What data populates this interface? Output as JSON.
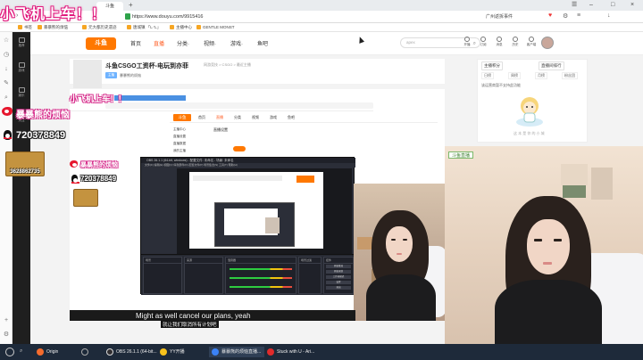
{
  "browser": {
    "tab_title": "斗鱼",
    "url": "https://www.douyu.com/9915416",
    "right_info": "广州返拆事件",
    "bookmarks": [
      "书签",
      "暴暴熊的烦恼",
      "元大都历史遗迹",
      "唐城镇 「L·'L」",
      "主播中心",
      "GENTLE MONST"
    ]
  },
  "overlay": {
    "title": "小飞机上车！！",
    "title_small": "小飞机上车！！",
    "name": "暴暴熊的烦恼",
    "qq": "720378849",
    "wechat": "3628862735",
    "name_small": "暴暴熊的烦恼",
    "qq_small": "720378849"
  },
  "dy_sidebar": [
    {
      "label": "推荐"
    },
    {
      "label": "游戏"
    },
    {
      "label": "娱乐"
    },
    {
      "label": "关注"
    }
  ],
  "header": {
    "logo": "斗鱼",
    "nav": [
      "首页",
      "直播",
      "分类·",
      "视频·",
      "游戏·",
      "鱼吧"
    ],
    "search_placeholder": "apex",
    "icons": [
      "开播",
      "订阅",
      "消息",
      "历史",
      "客户端"
    ]
  },
  "room": {
    "title": "斗鱼CSGO工资杯-电玩到亦菲",
    "sub": "网游竞技 > CSGO > 最近主播",
    "tag": "主播",
    "anchor": "暴暴熊的烦恼"
  },
  "rank": {
    "tabs": [
      "主播积分",
      "直播间排行"
    ],
    "subs": [
      "日榜",
      "周榜",
      "月榜",
      "粉丝团"
    ],
    "note": "该运营商暂不支持此功能",
    "footer": "这 本 是 你 的 小 城"
  },
  "inner": {
    "logo": "斗鱼",
    "nav": [
      "首页",
      "直播",
      "分类",
      "视频",
      "游戏",
      "鱼吧"
    ],
    "leftnav": [
      "主播中心",
      "直播设置",
      "直播数据",
      "我的主播"
    ],
    "section": "直播设置"
  },
  "obs": {
    "title": "OBS 26.1.1 (64-bit, windows) - 配置文件: 未命名 - 场景: 未命名",
    "menu": "文件(F)  编辑(E)  视图(V)  停靠部件(D)  配置文件(P)  场景集合(S)  工具(T)  帮助(H)",
    "panels": [
      "场景",
      "来源",
      "混音器",
      "场景过渡",
      "控件"
    ],
    "buttons": [
      "开始推流",
      "开始录制",
      "工作室模式",
      "设置",
      "退出"
    ]
  },
  "cam": {
    "label": "斗鱼直播"
  },
  "caption": {
    "en": "Might as well cancel our plans, yeah",
    "cn": "就让我们取消所有计划吧"
  },
  "taskbar": {
    "items": [
      {
        "label": "Origin"
      },
      {
        "label": ""
      },
      {
        "label": "OBS 26.1.1 (64-bit..."
      },
      {
        "label": "YY开播"
      },
      {
        "label": "暴暴熊的烦恼直播..."
      },
      {
        "label": "Stuck with U - Ari..."
      }
    ]
  },
  "colors": {
    "accent": "#ff5d23",
    "douyu_orange": "#ff7800",
    "overlay_pink": "#e0197d",
    "taskbar": "#1e2a3a"
  }
}
